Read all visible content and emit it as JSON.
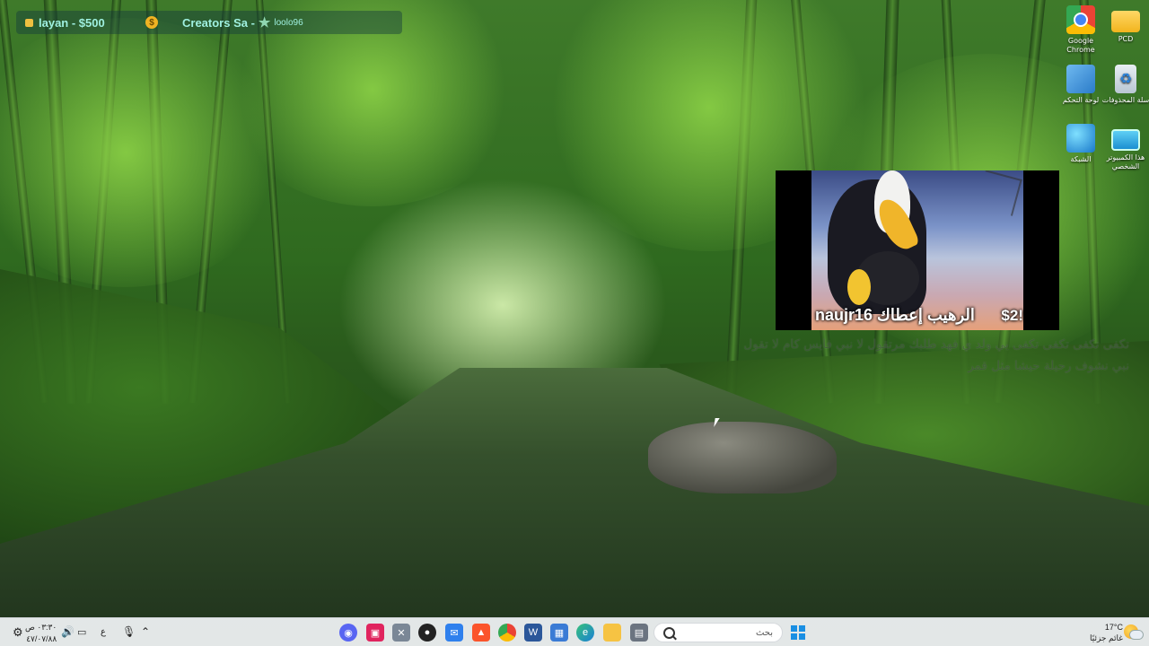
{
  "top_bar": {
    "item1": "layan - $500",
    "coin_symbol": "$",
    "item2": "Creators Sa -",
    "item3": "loolo96"
  },
  "desktop_icons": {
    "chrome": "Google Chrome",
    "pcd": "PCD",
    "control_panel": "لوحة التحكم",
    "recycle_bin": "سلة المحذوفات",
    "network": "الشبكة",
    "this_pc": "هذا الكمبيوتر الشخصي"
  },
  "video": {
    "name_text": "naujr16 الرهيب إعطاك",
    "amount_text": "$2!"
  },
  "caption": {
    "line1": "تكفى تكفى تكفى تكفى يي ولد ي فهد طلبك مرتقول لا نبي فايس كام لا تقول",
    "line2": "نبي نشوف رحيلة حيشا مثل قمر"
  },
  "taskbar": {
    "search_label": "بحث",
    "lang": "ع",
    "time": "٠٣:٣٠ ص",
    "date": "٤٧/٠٧/٨٨",
    "temperature": "17°C",
    "weather_text": "غائم جزئيًا"
  },
  "colors": {
    "overlay_text": "#9ff0e0",
    "taskbar_bg": "#ebeef0",
    "windows_blue": "#1a8fe3"
  }
}
